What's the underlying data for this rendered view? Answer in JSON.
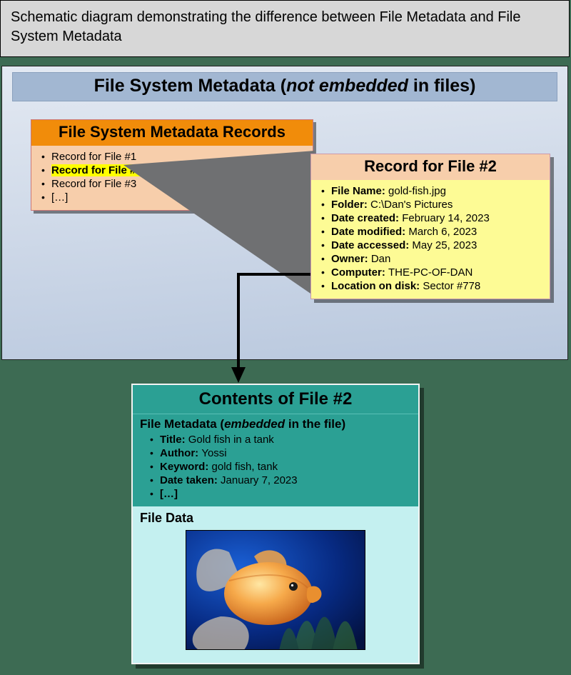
{
  "caption": "Schematic diagram demonstrating the difference between File Metadata and File System Metadata",
  "fs_panel": {
    "title_pre": "File System Metadata (",
    "title_em": "not embedded",
    "title_post": " in files)",
    "records_header": "File System Metadata Records",
    "records": [
      {
        "text": "Record for File #1",
        "highlight": false
      },
      {
        "text": "Record for File #2",
        "highlight": true
      },
      {
        "text": "Record for File #3",
        "highlight": false
      },
      {
        "text": "[…]",
        "highlight": false
      }
    ],
    "detail": {
      "header": "Record for File #2",
      "fields": [
        {
          "k": "File Name:",
          "v": "gold-fish.jpg"
        },
        {
          "k": "Folder:",
          "v": "C:\\Dan's Pictures"
        },
        {
          "k": "Date created:",
          "v": "February 14, 2023"
        },
        {
          "k": "Date modified:",
          "v": "March 6, 2023"
        },
        {
          "k": "Date accessed:",
          "v": "May 25, 2023"
        },
        {
          "k": "Owner:",
          "v": "Dan"
        },
        {
          "k": "Computer:",
          "v": "THE-PC-OF-DAN"
        },
        {
          "k": "Location on disk:",
          "v": "Sector #778"
        }
      ]
    }
  },
  "contents": {
    "title": "Contents of File #2",
    "file_meta_header_pre": "File Metadata (",
    "file_meta_header_em": "embedded",
    "file_meta_header_post": " in the file)",
    "file_meta": [
      {
        "k": "Title:",
        "v": "Gold fish in a tank"
      },
      {
        "k": "Author:",
        "v": "Yossi"
      },
      {
        "k": "Keyword:",
        "v": "gold fish, tank"
      },
      {
        "k": "Date taken:",
        "v": "January 7, 2023"
      },
      {
        "k": "[…]",
        "v": ""
      }
    ],
    "file_data_label": "File Data",
    "image_desc": "photo of a gold fish in a tank"
  }
}
